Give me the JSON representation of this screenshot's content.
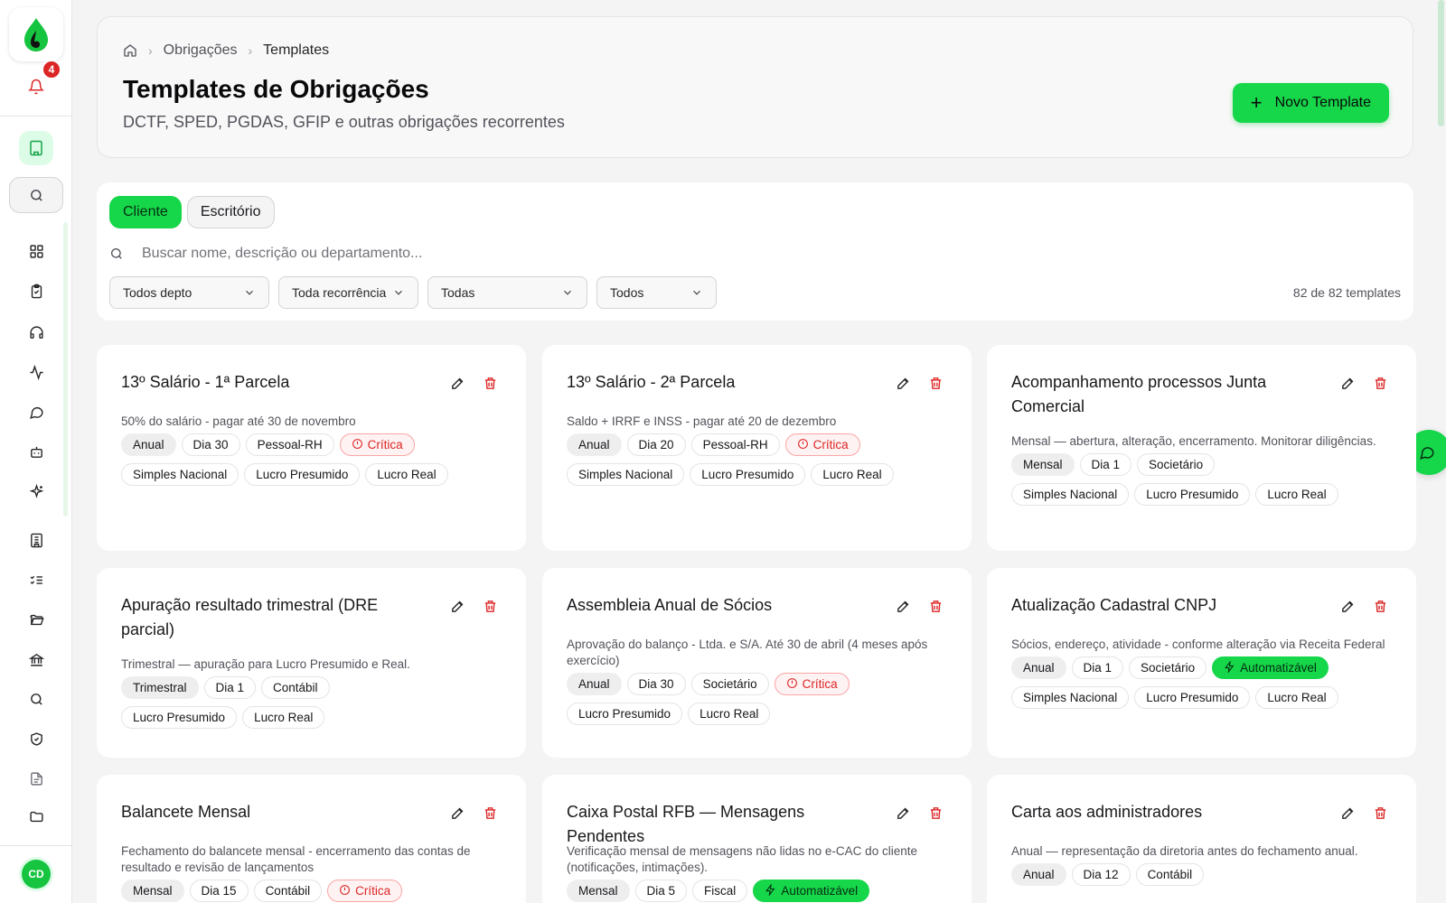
{
  "sidebar": {
    "notification_count": "4",
    "user_initials": "CD"
  },
  "header": {
    "breadcrumb": [
      "Obrigações",
      "Templates"
    ],
    "title": "Templates de Obrigações",
    "subtitle": "DCTF, SPED, PGDAS, GFIP e outras obrigações recorrentes",
    "new_button": "Novo Template"
  },
  "filters": {
    "tabs": [
      "Cliente",
      "Escritório"
    ],
    "search_placeholder": "Buscar nome, descrição ou departamento...",
    "selects": [
      "Todos depto",
      "Toda recorrência",
      "Todas",
      "Todos"
    ],
    "count": "82 de 82 templates"
  },
  "cards": [
    {
      "title": "13º Salário - 1ª Parcela",
      "desc": "50% do salário - pagar até 30 de novembro",
      "row1": [
        "Anual",
        "Dia 30",
        "Pessoal-RH"
      ],
      "flag": "Crítica",
      "regimes": [
        "Simples Nacional",
        "Lucro Presumido",
        "Lucro Real"
      ]
    },
    {
      "title": "13º Salário - 2ª Parcela",
      "desc": "Saldo + IRRF e INSS - pagar até 20 de dezembro",
      "row1": [
        "Anual",
        "Dia 20",
        "Pessoal-RH"
      ],
      "flag": "Crítica",
      "regimes": [
        "Simples Nacional",
        "Lucro Presumido",
        "Lucro Real"
      ]
    },
    {
      "title": "Acompanhamento processos Junta Comercial",
      "desc": "Mensal — abertura, alteração, encerramento. Monitorar diligências.",
      "row1": [
        "Mensal",
        "Dia 1",
        "Societário"
      ],
      "regimes": [
        "Simples Nacional",
        "Lucro Presumido",
        "Lucro Real"
      ]
    },
    {
      "title": "Apuração resultado trimestral (DRE parcial)",
      "desc": "Trimestral — apuração para Lucro Presumido e Real.",
      "row1": [
        "Trimestral",
        "Dia 1",
        "Contábil"
      ],
      "regimes": [
        "Lucro Presumido",
        "Lucro Real"
      ]
    },
    {
      "title": "Assembleia Anual de Sócios",
      "desc": "Aprovação do balanço - Ltda. e S/A. Até 30 de abril (4 meses após exercício)",
      "row1": [
        "Anual",
        "Dia 30",
        "Societário"
      ],
      "flag": "Crítica",
      "regimes": [
        "Lucro Presumido",
        "Lucro Real"
      ]
    },
    {
      "title": "Atualização Cadastral CNPJ",
      "desc": "Sócios, endereço, atividade - conforme alteração via Receita Federal",
      "row1": [
        "Anual",
        "Dia 1",
        "Societário"
      ],
      "auto": "Automatizável",
      "regimes": [
        "Simples Nacional",
        "Lucro Presumido",
        "Lucro Real"
      ]
    },
    {
      "title": "Balancete Mensal",
      "desc": "Fechamento do balancete mensal - encerramento das contas de resultado e revisão de lançamentos",
      "row1": [
        "Mensal",
        "Dia 15",
        "Contábil"
      ],
      "flag": "Crítica",
      "regimes": []
    },
    {
      "title": "Caixa Postal RFB — Mensagens Pendentes",
      "desc": "Verificação mensal de mensagens não lidas no e-CAC do cliente (notificações, intimações).",
      "row1": [
        "Mensal",
        "Dia 5",
        "Fiscal"
      ],
      "auto": "Automatizável",
      "regimes": []
    },
    {
      "title": "Carta aos administradores",
      "desc": "Anual — representação da diretoria antes do fechamento anual.",
      "row1": [
        "Anual",
        "Dia 12",
        "Contábil"
      ],
      "regimes": []
    }
  ],
  "colors": {
    "brand": "#16d64a",
    "critical": "#dc2626"
  },
  "icons": [
    "home-icon",
    "chevron-right-icon",
    "plus-icon",
    "search-icon",
    "chevron-down-icon",
    "pencil-icon",
    "trash-icon",
    "alert-circle-icon",
    "bolt-icon",
    "chat-icon",
    "bell-icon",
    "building-icon",
    "grid-icon",
    "clipboard-icon",
    "headset-icon",
    "activity-icon",
    "message-icon",
    "bot-icon",
    "sparkles-icon",
    "list-check-icon",
    "folder-icon",
    "bank-icon",
    "shield-icon",
    "file-text-icon"
  ]
}
